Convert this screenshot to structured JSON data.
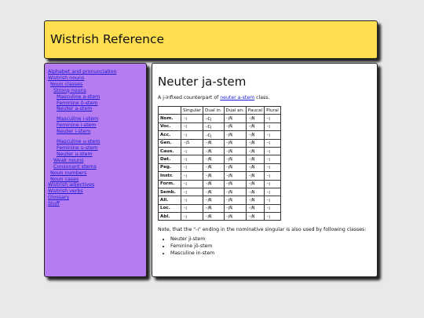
{
  "header": {
    "title": "Wistrish Reference"
  },
  "sidebar": {
    "items": [
      {
        "label": "Alphabet and pronunciation",
        "level": 0
      },
      {
        "label": "Wistrish nouns",
        "level": 0
      },
      {
        "label": "Noun classes",
        "level": 1
      },
      {
        "label": "Strong nouns",
        "level": 2
      },
      {
        "label": "Masculine a-stem",
        "level": 3
      },
      {
        "label": "Feminine ō-stem",
        "level": 3
      },
      {
        "label": "Neuter a-stem",
        "level": 3
      },
      {
        "label": "Masculine i-stem",
        "level": 3,
        "gap": true
      },
      {
        "label": "Feminine i-stem",
        "level": 3
      },
      {
        "label": "Neuter i-stem",
        "level": 3
      },
      {
        "label": "Masculine u-stem",
        "level": 3,
        "gap": true
      },
      {
        "label": "Feminine u-stem",
        "level": 3
      },
      {
        "label": "Neuter u-stem",
        "level": 3
      },
      {
        "label": "Weak nouns",
        "level": 2
      },
      {
        "label": "Consonant stems",
        "level": 2
      },
      {
        "label": "Noun numbers",
        "level": 1
      },
      {
        "label": "Noun cases",
        "level": 1
      },
      {
        "label": "Wistrish adjectives",
        "level": 0
      },
      {
        "label": "Wistrish verbs",
        "level": 0
      },
      {
        "label": "Glossary",
        "level": 0
      },
      {
        "label": "Stuff",
        "level": 0
      }
    ]
  },
  "main": {
    "title": "Neuter ja-stem",
    "intro_prefix": "A j-infixed counterpart of ",
    "intro_link": "neuter a-stem",
    "intro_suffix": " class.",
    "table": {
      "columns": [
        "",
        "Singular",
        "Dual in.",
        "Dual an.",
        "Paucal",
        "Plural"
      ],
      "rows": [
        {
          "case": "Nom.",
          "cells": [
            "-ꞁ",
            "-Ꞓꞁ",
            "-ꞁꞐ",
            "-ꞁꞐ",
            "-ꞁ"
          ],
          "sep": false
        },
        {
          "case": "Voc.",
          "cells": [
            "-ꞁ",
            "-Ꞓꞁ",
            "-ꞁꞐ",
            "-ꞁꞐ",
            "-ꞁ"
          ],
          "sep": false
        },
        {
          "case": "Acc.",
          "cells": [
            "-ꞁ",
            "-Ꞓꞁ",
            "-ꞁꞐ",
            "-ꞁꞐ",
            "-ꞁ"
          ],
          "sep": false
        },
        {
          "case": "Gen.",
          "cells": [
            "-ꞁS",
            "-ꞁꞐ",
            "-ꞁꞐ",
            "-ꞁꞐ",
            "-ꞁ"
          ],
          "sep": true
        },
        {
          "case": "Caus.",
          "cells": [
            "-ꞁ",
            "-ꞁꞐ",
            "-ꞁꞐ",
            "-ꞁꞐ",
            "-ꞁ"
          ],
          "sep": true
        },
        {
          "case": "Dat.",
          "cells": [
            "-ꞁ",
            "-ꞁꞐ",
            "-ꞁꞐ",
            "-ꞁꞐ",
            "-ꞁ"
          ],
          "sep": false
        },
        {
          "case": "Peg.",
          "cells": [
            "-ꞁ",
            "-ꞁꞐ",
            "-ꞁꞐ",
            "-ꞁꞐ",
            "-ꞁ"
          ],
          "sep": false
        },
        {
          "case": "Instr.",
          "cells": [
            "-ꞁ",
            "-ꞁꞐ",
            "-ꞁꞐ",
            "-ꞁꞐ",
            "-ꞁ"
          ],
          "sep": false
        },
        {
          "case": "Form.",
          "cells": [
            "-ꞁ",
            "-ꞁꞐ",
            "-ꞁꞐ",
            "-ꞁꞐ",
            "-ꞁ"
          ],
          "sep": false
        },
        {
          "case": "Semb.",
          "cells": [
            "-ꞁ",
            "-ꞁꞐ",
            "-ꞁꞐ",
            "-ꞁꞐ",
            "-ꞁ"
          ],
          "sep": false
        },
        {
          "case": "All.",
          "cells": [
            "-ꞁ",
            "-ꞁꞐ",
            "-ꞁꞐ",
            "-ꞁꞐ",
            "-ꞁ"
          ],
          "sep": true
        },
        {
          "case": "Loc.",
          "cells": [
            "-ꞁ",
            "-ꞁꞐ",
            "-ꞁꞐ",
            "-ꞁꞐ",
            "-ꞁ"
          ],
          "sep": false
        },
        {
          "case": "Abl.",
          "cells": [
            "-ꞁ",
            "-ꞁꞐ",
            "-ꞁꞐ",
            "-ꞁꞐ",
            "-ꞁ"
          ],
          "sep": false
        }
      ]
    },
    "note": "Note, that the \"-ı\" ending in the nominative singular is also used by following classes:",
    "classes": [
      "Neuter ji-stem",
      "Feminine jō-stem",
      "Masculine in-stem"
    ]
  }
}
